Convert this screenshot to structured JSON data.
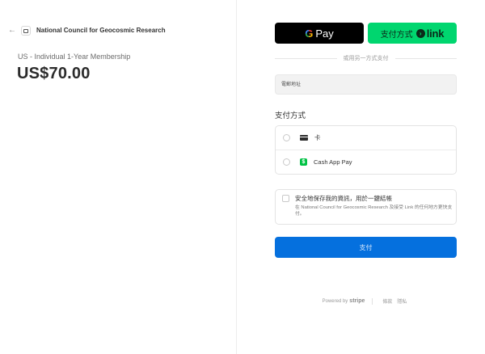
{
  "merchant": {
    "back_glyph": "←",
    "name": "National Council for Geocosmic Research"
  },
  "order": {
    "product": "US - Individual 1-Year Membership",
    "price": "US$70.00"
  },
  "express": {
    "gpay_g": "G",
    "gpay_label": "Pay",
    "link_label": "支付方式",
    "link_arrow": "›",
    "link_word": "link"
  },
  "divider_text": "或用另一方式支付",
  "email": {
    "placeholder": "電郵地址",
    "value": ""
  },
  "payment_section": {
    "title": "支付方式",
    "methods": [
      {
        "label": "卡",
        "icon": "card-icon"
      },
      {
        "label": "Cash App Pay",
        "icon": "cashapp-icon",
        "icon_glyph": "$"
      }
    ]
  },
  "save_info": {
    "title": "安全地保存我的資訊，用於一鍵結帳",
    "description": "在 National Council for Geocosmic Research 及接受 Link 的任何地方更快支付。"
  },
  "pay_button": "支付",
  "footer": {
    "powered_by": "Powered by",
    "stripe": "stripe",
    "terms": "條款",
    "privacy": "隱私"
  },
  "colors": {
    "pay_button": "#0570de",
    "link_button": "#00d66f",
    "gpay_button": "#000000"
  }
}
